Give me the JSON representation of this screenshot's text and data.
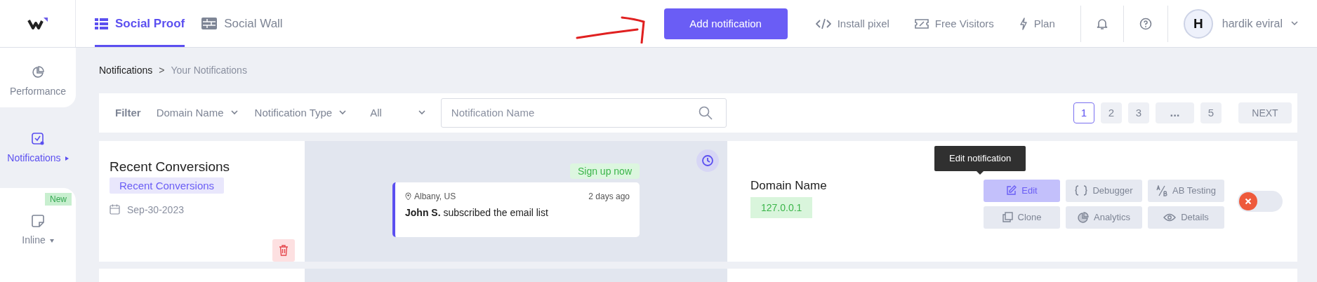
{
  "nav_tabs": [
    {
      "label": "Social Proof",
      "selected": true
    },
    {
      "label": "Social Wall",
      "selected": false
    }
  ],
  "primary_button": "Add notification",
  "top_links": [
    {
      "label": "Install pixel"
    },
    {
      "label": "Free Visitors"
    },
    {
      "label": "Plan"
    }
  ],
  "user": {
    "initial": "H",
    "name": "hardik eviral"
  },
  "sidebar": {
    "items": [
      {
        "label": "Performance",
        "selected": false,
        "caret": false
      },
      {
        "label": "Notifications",
        "selected": true,
        "caret": true
      },
      {
        "label": "Inline",
        "selected": false,
        "caret": true,
        "badge": "New"
      }
    ]
  },
  "breadcrumb": {
    "parent": "Notifications",
    "separator": ">",
    "current": "Your Notifications"
  },
  "filter": {
    "label": "Filter",
    "dropdowns": [
      "Domain Name",
      "Notification Type",
      "All"
    ],
    "search": {
      "placeholder": "Notification Name"
    },
    "pages": [
      {
        "label": "1",
        "selected": true
      },
      {
        "label": "2",
        "selected": false
      },
      {
        "label": "3",
        "selected": false
      },
      {
        "label": "...",
        "selected": false
      },
      {
        "label": "5",
        "selected": false
      }
    ],
    "next": "NEXT"
  },
  "notification": {
    "title": "Recent Conversions",
    "type_tag": "Recent Conversions",
    "date": "Sep-30-2023",
    "preview": {
      "badge": "Sign up now",
      "location": "Albany, US",
      "time": "2 days ago",
      "message": "**John S.** subscribed the email list"
    },
    "domain_label": "Domain Name",
    "domain": "127.0.0.1",
    "tooltip": "Edit notification",
    "actions": [
      {
        "label": "Edit",
        "hovered": true
      },
      {
        "label": "Debugger",
        "hovered": false
      },
      {
        "label": "AB Testing",
        "hovered": false
      },
      {
        "label": "Clone",
        "hovered": false
      },
      {
        "label": "Analytics",
        "hovered": false
      },
      {
        "label": "Details",
        "hovered": false
      }
    ],
    "on": false
  }
}
